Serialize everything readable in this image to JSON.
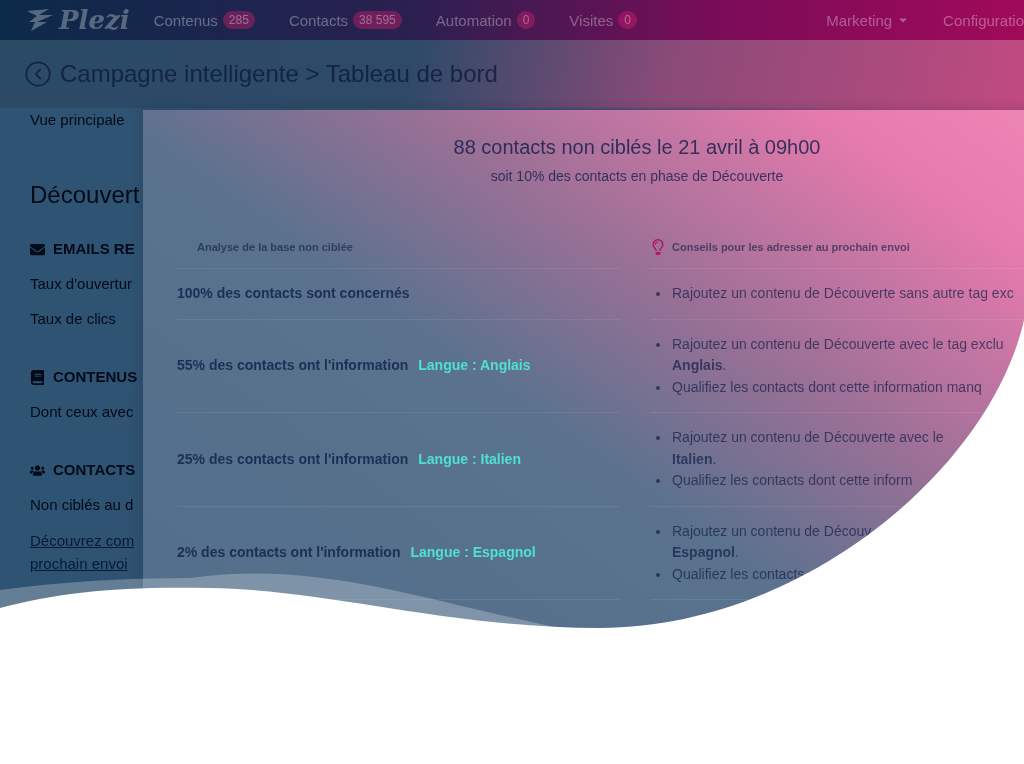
{
  "navbar": {
    "logo": "Plezi",
    "items": [
      {
        "label": "Contenus",
        "count": "285"
      },
      {
        "label": "Contacts",
        "count": "38 595"
      },
      {
        "label": "Automation",
        "count": "0"
      },
      {
        "label": "Visites",
        "count": "0"
      }
    ],
    "right_items": [
      {
        "label": "Marketing",
        "kind": "dropdown"
      },
      {
        "label": "Configuratio",
        "kind": "link"
      }
    ]
  },
  "breadcrumb": "Campagne intelligente > Tableau de bord",
  "sidebar": {
    "tab": "Vue principale",
    "heading": "Découvert",
    "sections": [
      {
        "kind": "envelope",
        "title": "EMAILS RE",
        "lines": [
          "Taux d'ouvertur",
          "Taux de clics"
        ]
      },
      {
        "kind": "book",
        "title": "CONTENUS",
        "lines": [
          "Dont ceux avec"
        ]
      },
      {
        "kind": "users",
        "title": "CONTACTS",
        "lines": [
          "Non ciblés au d"
        ],
        "link": [
          "Découvrez com",
          "prochain envoi"
        ]
      }
    ]
  },
  "panel": {
    "title": "88 contacts non ciblés le 21 avril à 09h00",
    "subtitle": "soit 10% des contacts en phase de Découverte",
    "columns": [
      "Analyse de la base non ciblée",
      "Conseils pour les adresser au prochain envoi"
    ],
    "rows": [
      {
        "analysis": "100% des contacts sont concernés",
        "advice": [
          [
            "Rajoutez un contenu de Découverte sans autre tag exc"
          ]
        ]
      },
      {
        "analysis": "55% des contacts ont l'information",
        "tag": "Langue : Anglais",
        "advice": [
          [
            "Rajoutez un contenu de Découverte avec le tag exclu",
            "**Anglais**."
          ],
          [
            "Qualifiez les contacts dont cette information manq"
          ]
        ]
      },
      {
        "analysis": "25% des contacts ont l'information",
        "tag": "Langue : Italien",
        "advice": [
          [
            "Rajoutez un contenu de Découverte avec le",
            "**Italien**."
          ],
          [
            "Qualifiez les contacts dont cette inform"
          ]
        ]
      },
      {
        "analysis": "2% des contacts ont l'information",
        "tag": "Langue : Espagnol",
        "advice": [
          [
            "Rajoutez un contenu de Découv",
            "**Espagnol**."
          ],
          [
            "Qualifiez les contacts"
          ]
        ]
      }
    ]
  }
}
